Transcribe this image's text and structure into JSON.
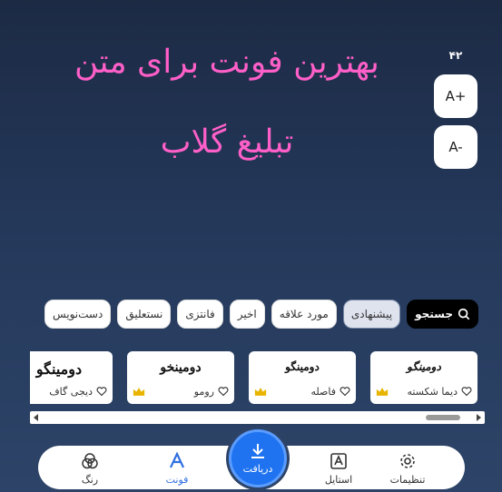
{
  "preview": {
    "line1": "بهترین فونت برای متن",
    "line2": "تبلیغ گلاب",
    "color": "#ff5fc8"
  },
  "size": {
    "value": "۴۲",
    "increase_label": "A+",
    "decrease_label": "A-"
  },
  "categories": {
    "search_label": "جستجو",
    "items": [
      {
        "label": "پیشنهادی",
        "active": true
      },
      {
        "label": "مورد علاقه",
        "active": false
      },
      {
        "label": "اخیر",
        "active": false
      },
      {
        "label": "فانتزی",
        "active": false
      },
      {
        "label": "نستعلیق",
        "active": false
      },
      {
        "label": "دست‌نویس",
        "active": false
      }
    ]
  },
  "fonts": [
    {
      "sample": "دومینگو",
      "name": "دیما شکسته",
      "premium": true
    },
    {
      "sample": "دومینگو",
      "name": "فاصله",
      "premium": true
    },
    {
      "sample": "دومینخو",
      "name": "رومو",
      "premium": true
    },
    {
      "sample": "دومینگو",
      "name": "دیجی گاف",
      "premium": false
    }
  ],
  "nav": {
    "settings": "تنظیمات",
    "style": "استایل",
    "download": "دریافت",
    "font": "فونت",
    "color": "رنگ",
    "active_color": "#2f6fe0",
    "download_color": "#1f73f0"
  }
}
